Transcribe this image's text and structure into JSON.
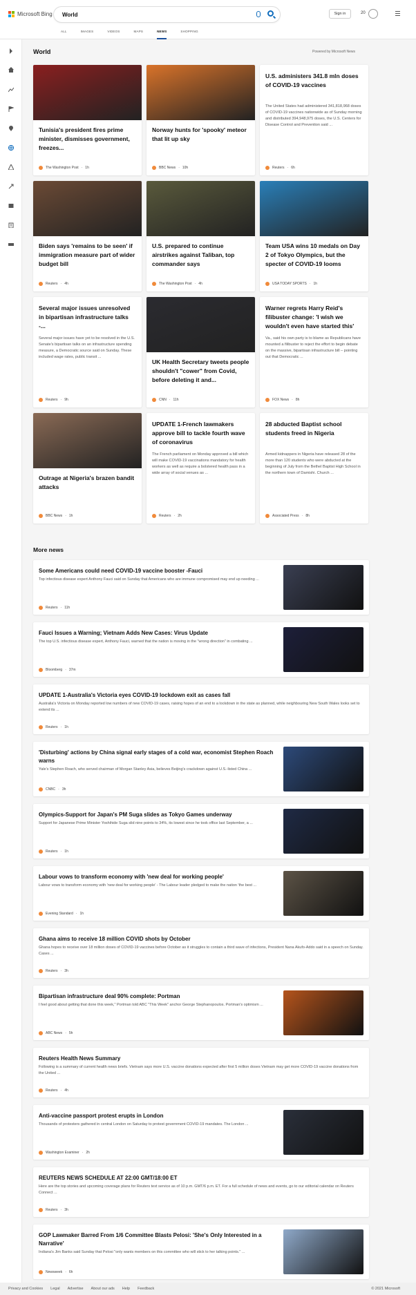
{
  "header": {
    "brand": "Microsoft Bing",
    "search_value": "World",
    "signin": "Sign in",
    "points": "20",
    "tabs": [
      "ALL",
      "IMAGES",
      "VIDEOS",
      "MAPS",
      "NEWS",
      "SHOPPING"
    ],
    "active_tab": "NEWS"
  },
  "section": {
    "title": "World",
    "powered_by": "Powered by Microsoft News"
  },
  "cards": [
    {
      "title": "Tunisia's president fires prime minister, dismisses government, freezes...",
      "desc": "",
      "source": "The Washington Post",
      "time": "1h",
      "img_color": "#8a1f1f"
    },
    {
      "title": "Norway hunts for 'spooky' meteor that lit up sky",
      "desc": "",
      "source": "BBC News",
      "time": "10h",
      "img_color": "#d9732a"
    },
    {
      "title": "U.S. administers 341.8 mln doses of COVID-19 vaccines",
      "desc": "The United States had administered 341,818,968 doses of COVID-19 vaccines nationwide as of Sunday morning and distributed 394,948,975 doses, the U.S. Centers for Disease Control and Prevention said ...",
      "source": "Reuters",
      "time": "6h",
      "img_color": ""
    },
    {
      "title": "Biden says 'remains to be seen' if immigration measure part of wider budget bill",
      "desc": "",
      "source": "Reuters",
      "time": "4h",
      "img_color": "#6b4a35"
    },
    {
      "title": "U.S. prepared to continue airstrikes against Taliban, top commander says",
      "desc": "",
      "source": "The Washington Post",
      "time": "4h",
      "img_color": "#5a5a3c"
    },
    {
      "title": "Team USA wins 10 medals on Day 2 of Tokyo Olympics, but the specter of COVID-19 looms",
      "desc": "",
      "source": "USA TODAY SPORTS",
      "time": "1h",
      "img_color": "#2a7fb8"
    },
    {
      "title": "Several major issues unresolved in bipartisan infrastructure talks -...",
      "desc": "Several major issues have yet to be resolved in the U.S. Senate's bipartisan talks on an infrastructure spending measure, a Democratic source said on Sunday. These included wage rates, public transit ...",
      "source": "Reuters",
      "time": "9h",
      "img_color": ""
    },
    {
      "title": "UK Health Secretary tweets people shouldn't \"cower\" from Covid, before deleting it and...",
      "desc": "",
      "source": "CNN",
      "time": "11h",
      "img_color": "#2b2b30"
    },
    {
      "title": "Warner regrets Harry Reid's filibuster change: 'I wish we wouldn't even have started this'",
      "desc": "Va., said his own party is to blame as Republicans have mounted a filibuster to reject the effort to begin debate on the massive, bipartisan infrastructure bill – pointing out that Democratic ...",
      "source": "FOX News",
      "time": "8h",
      "img_color": ""
    },
    {
      "title": "Outrage at Nigeria's brazen bandit attacks",
      "desc": "",
      "source": "BBC News",
      "time": "1h",
      "img_color": "#8a6a55"
    },
    {
      "title": "UPDATE 1-French lawmakers approve bill to tackle fourth wave of coronavirus",
      "desc": "The French parliament on Monday approved a bill which will make COVID-19 vaccinations mandatory for health workers as well as require a bolstered health pass in a wide array of social venues as ...",
      "source": "Reuters",
      "time": "2h",
      "img_color": ""
    },
    {
      "title": "28 abducted Baptist school students freed in Nigeria",
      "desc": "Armed kidnappers in Nigeria have released 28 of the more than 120 students who were abducted at the beginning of July from the Bethel Baptist High School in the northern town of Damishi. Church ...",
      "source": "Associated Press",
      "time": "8h",
      "img_color": ""
    }
  ],
  "more_news_title": "More news",
  "more_news": [
    {
      "title": "Some Americans could need COVID-19 vaccine booster -Fauci",
      "desc": "Top infectious disease expert Anthony Fauci said on Sunday that Americans who are immune compromised may end up needing ...",
      "source": "Reuters",
      "time": "11h",
      "img_color": "#3a3f52"
    },
    {
      "title": "Fauci Issues a Warning; Vietnam Adds New Cases: Virus Update",
      "desc": "The top U.S. infectious disease expert, Anthony Fauci, warned that the nation is moving in the \"wrong direction\" in combating ...",
      "source": "Bloomberg",
      "time": "37m",
      "img_color": "#1d1f3a"
    },
    {
      "title": "UPDATE 1-Australia's Victoria eyes COVID-19 lockdown exit as cases fall",
      "desc": "Australia's Victoria on Monday reported low numbers of new COVID-19 cases, raising hopes of an end to a lockdown in the state as planned, while neighbouring New South Wales looks set to extend its ...",
      "source": "Reuters",
      "time": "1h",
      "img_color": ""
    },
    {
      "title": "'Disturbing' actions by China signal early stages of a cold war, economist Stephen Roach warns",
      "desc": "Yale's Stephen Roach, who served chairman of Morgan Stanley Asia, believes Beijing's crackdown against U.S.-listed China ...",
      "source": "CNBC",
      "time": "3h",
      "img_color": "#2d4a7a"
    },
    {
      "title": "Olympics-Support for Japan's PM Suga slides as Tokyo Games underway",
      "desc": "Support for Japanese Prime Minister Yoshihide Suga slid nine points to 34%, its lowest since he took office last September, a ...",
      "source": "Reuters",
      "time": "1h",
      "img_color": "#1f2a45"
    },
    {
      "title": "Labour vows to transform economy with 'new deal for working people'",
      "desc": "Labour vows to transform economy with 'new deal for working people' - The Labour leader pledged to make the nation 'the best ...",
      "source": "Evening Standard",
      "time": "1h",
      "img_color": "#5c5346"
    },
    {
      "title": "Ghana aims to receive 18 million COVID shots by October",
      "desc": "Ghana hopes to receive over 18 million doses of COVID-19 vaccines before October as it struggles to contain a third wave of infections, President Nana Akufo-Addo said in a speech on Sunday. Cases ...",
      "source": "Reuters",
      "time": "3h",
      "img_color": ""
    },
    {
      "title": "Bipartisan infrastructure deal 90% complete: Portman",
      "desc": "I feel good about getting that done this week,\" Portman told ABC \"This Week\" anchor George Stephanopoulos. Portman's optimism ...",
      "source": "ABC News",
      "time": "5h",
      "img_color": "#b5541c"
    },
    {
      "title": "Reuters Health News Summary",
      "desc": "Following is a summary of current health news briefs. Vietnam says more U.S. vaccine donations expected after first 5 million doses Vietnam may get more COVID-19 vaccine donations from the United ...",
      "source": "Reuters",
      "time": "4h",
      "img_color": ""
    },
    {
      "title": "Anti-vaccine passport protest erupts in London",
      "desc": "Thousands of protesters gathered in central London on Saturday to protest government COVID-19 mandates. The London ...",
      "source": "Washington Examiner",
      "time": "2h",
      "img_color": "#2a2f3a"
    },
    {
      "title": "REUTERS NEWS SCHEDULE AT 22:00 GMT/18:00 ET",
      "desc": "Here are the top stories and upcoming coverage plans for Reuters text service as of 10 p.m. GMT/6 p.m. ET. For a full schedule of news and events, go to our editorial calendar on Reuters Connect ...",
      "source": "Reuters",
      "time": "3h",
      "img_color": ""
    },
    {
      "title": "GOP Lawmaker Barred From 1/6 Committee Blasts Pelosi: 'She's Only Interested in a Narrative'",
      "desc": "Indiana's Jim Banks said Sunday that Pelosi \"only wants members on this committee who will stick to her talking points.\" ...",
      "source": "Newsweek",
      "time": "6h",
      "img_color": "#8fa9c9"
    }
  ],
  "footer": {
    "links": [
      "Privacy and Cookies",
      "Legal",
      "Advertise",
      "About our ads",
      "Help",
      "Feedback"
    ],
    "copyright": "© 2021 Microsoft"
  }
}
